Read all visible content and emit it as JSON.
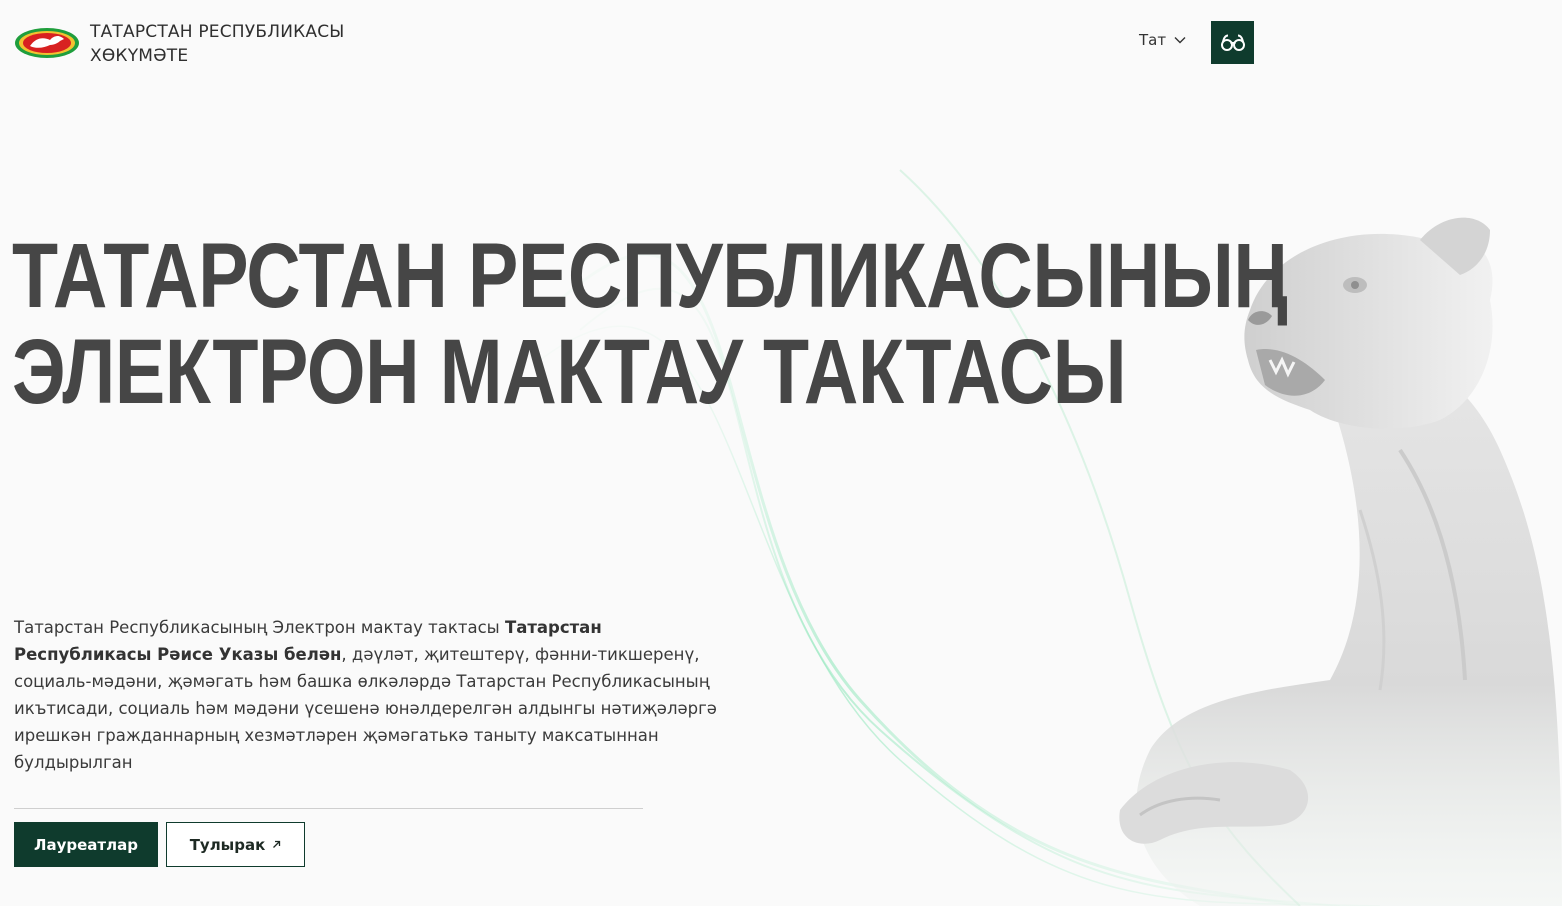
{
  "header": {
    "org_line1": "ТАТАРСТАН РЕСПУБЛИКАСЫ",
    "org_line2": "ХӨКҮМӘТЕ",
    "language": "Тат",
    "vision_icon": "glasses-icon"
  },
  "hero": {
    "title_line1": "ТАТАРСТАН РЕСПУБЛИКАСЫНЫҢ",
    "title_line2": "ЭЛЕКТРОН МАКТАУ ТАКТАСЫ",
    "desc_part1": "Татарстан Республикасының Электрон мактау тактасы ",
    "desc_bold": "Татарстан Республикасы Рәисе Указы белән",
    "desc_part2": ", дәүләт, җитештерү, фәнни-тикшеренү, социаль-мәдәни, җәмәгать һәм башка өлкәләрдә Татарстан Республикасының икътисади, социаль һәм мәдәни үсешенә юнәлдерелгән алдынгы нәтиҗәләргә ирешкән гражданнарның хезмәтләрен җәмәгатькә таныту максатыннан булдырылган"
  },
  "actions": {
    "laureates_label": "Лауреатлар",
    "more_label": "Тулырак",
    "more_icon": "external-arrow-icon"
  },
  "colors": {
    "primary": "#0f3b2d",
    "headline": "#464646",
    "background": "#fafafa",
    "accent_wave": "#7ee3b0"
  }
}
